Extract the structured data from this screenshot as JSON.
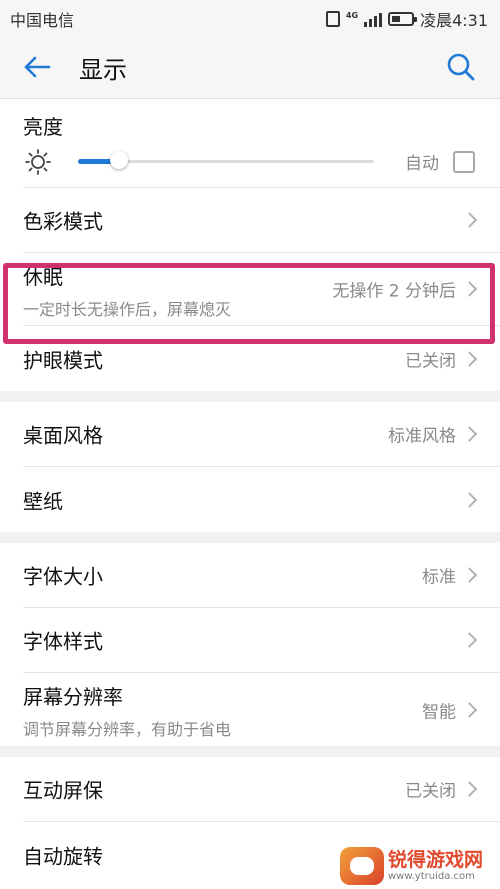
{
  "status_bar": {
    "carrier": "中国电信",
    "network": "4G",
    "time": "凌晨4:31",
    "battery_level": 0.55
  },
  "app_bar": {
    "title": "显示",
    "back_icon": "arrow-left-icon",
    "search_icon": "search-icon"
  },
  "colors": {
    "accent": "#1f7ad6",
    "highlight": "#d0306b",
    "background": "#f1f1f1"
  },
  "brightness": {
    "label": "亮度",
    "level": 0.14,
    "auto_label": "自动",
    "auto_checked": false,
    "icon": "sun-icon"
  },
  "items": {
    "color_mode": {
      "label": "色彩模式"
    },
    "sleep": {
      "label": "休眠",
      "subtitle": "一定时长无操作后，屏幕熄灭",
      "value": "无操作 2 分钟后"
    },
    "eye_comfort": {
      "label": "护眼模式",
      "value": "已关闭"
    },
    "home_style": {
      "label": "桌面风格",
      "value": "标准风格"
    },
    "wallpaper": {
      "label": "壁纸"
    },
    "font_size": {
      "label": "字体大小",
      "value": "标准"
    },
    "font_style": {
      "label": "字体样式"
    },
    "resolution": {
      "label": "屏幕分辨率",
      "subtitle": "调节屏幕分辨率，有助于省电",
      "value": "智能"
    },
    "screensaver": {
      "label": "互动屏保",
      "value": "已关闭"
    },
    "auto_rotate": {
      "label": "自动旋转"
    }
  },
  "watermark": {
    "title": "锐得游戏网",
    "url": "www.ytruida.com"
  }
}
